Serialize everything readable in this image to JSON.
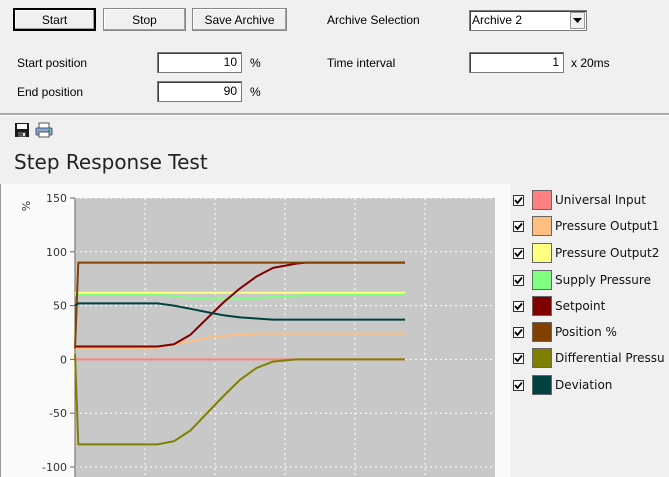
{
  "toolbar": {
    "start_label": "Start",
    "stop_label": "Stop",
    "save_archive_label": "Save Archive",
    "archive_selection_label": "Archive Selection",
    "archive_selected": "Archive 2"
  },
  "params": {
    "start_position_label": "Start position",
    "start_position_value": "10",
    "start_position_unit": "%",
    "end_position_label": "End position",
    "end_position_value": "90",
    "end_position_unit": "%",
    "time_interval_label": "Time interval",
    "time_interval_value": "1",
    "time_interval_unit": "x 20ms"
  },
  "chart_title": "Step Response Test",
  "chart_data": {
    "type": "line",
    "title": "Step Response Test",
    "ylabel": "%",
    "xlabel": "",
    "ylim": [
      -100,
      150
    ],
    "yticks": [
      150,
      100,
      50,
      0,
      -50,
      -100
    ],
    "grid": true,
    "legend_position": "right",
    "x_units": "samples",
    "x": [
      0,
      1,
      10,
      17,
      25,
      30,
      35,
      40,
      45,
      50,
      55,
      60,
      67,
      70,
      75,
      80,
      85,
      90,
      95,
      100
    ],
    "series": [
      {
        "name": "Universal Input",
        "color": "#ff8080",
        "values": [
          0,
          0,
          0,
          0,
          0,
          0,
          0,
          0,
          0,
          0,
          0,
          0,
          0,
          0,
          0,
          0,
          0,
          0,
          0,
          0
        ]
      },
      {
        "name": "Pressure Output1",
        "color": "#ffbf80",
        "values": [
          10,
          10,
          10,
          10,
          11,
          14,
          17,
          20,
          22,
          23,
          24,
          24,
          24,
          24,
          24,
          24,
          24,
          24,
          24,
          24
        ]
      },
      {
        "name": "Pressure Output2",
        "color": "#ffff80",
        "values": [
          62,
          62,
          62,
          62,
          62,
          62,
          62,
          62,
          62,
          62,
          62,
          62,
          62,
          62,
          62,
          62,
          62,
          62,
          62,
          62
        ]
      },
      {
        "name": "Supply Pressure",
        "color": "#80ff80",
        "values": [
          60,
          60,
          60,
          60,
          60,
          59,
          57,
          56,
          56,
          56,
          57,
          58,
          59,
          60,
          60,
          60,
          60,
          60,
          60,
          60
        ]
      },
      {
        "name": "Setpoint",
        "color": "#800000",
        "values": [
          12,
          12,
          12,
          12,
          12,
          14,
          23,
          38,
          53,
          66,
          77,
          85,
          89,
          90,
          90,
          90,
          90,
          90,
          90,
          90
        ]
      },
      {
        "name": "Position %",
        "color": "#804000",
        "values": [
          10,
          90,
          90,
          90,
          90,
          90,
          90,
          90,
          90,
          90,
          90,
          90,
          90,
          90,
          90,
          90,
          90,
          90,
          90,
          90
        ]
      },
      {
        "name": "Differential Pressure",
        "color": "#808000",
        "values": [
          5,
          -79,
          -79,
          -79,
          -79,
          -76,
          -66,
          -50,
          -34,
          -19,
          -8,
          -2,
          0,
          0,
          0,
          0,
          0,
          0,
          0,
          0
        ]
      },
      {
        "name": "Deviation",
        "color": "#004040",
        "values": [
          50,
          52,
          52,
          52,
          52,
          50,
          47,
          44,
          41,
          39,
          38,
          37,
          37,
          37,
          37,
          37,
          37,
          37,
          37,
          37
        ]
      }
    ]
  },
  "legend": [
    {
      "label": "Universal Input",
      "color": "#ff8080",
      "checked": true
    },
    {
      "label": "Pressure Output1",
      "color": "#ffbf80",
      "checked": true
    },
    {
      "label": "Pressure Output2",
      "color": "#ffff80",
      "checked": true
    },
    {
      "label": "Supply Pressure",
      "color": "#80ff80",
      "checked": true
    },
    {
      "label": "Setpoint",
      "color": "#800000",
      "checked": true
    },
    {
      "label": "Position %",
      "color": "#804000",
      "checked": true
    },
    {
      "label": "Differential Pressu",
      "color": "#808000",
      "checked": true
    },
    {
      "label": "Deviation",
      "color": "#004040",
      "checked": true
    }
  ],
  "icons": {
    "save": "save-icon",
    "print": "print-icon",
    "dropdown": "chevron-down-icon"
  }
}
